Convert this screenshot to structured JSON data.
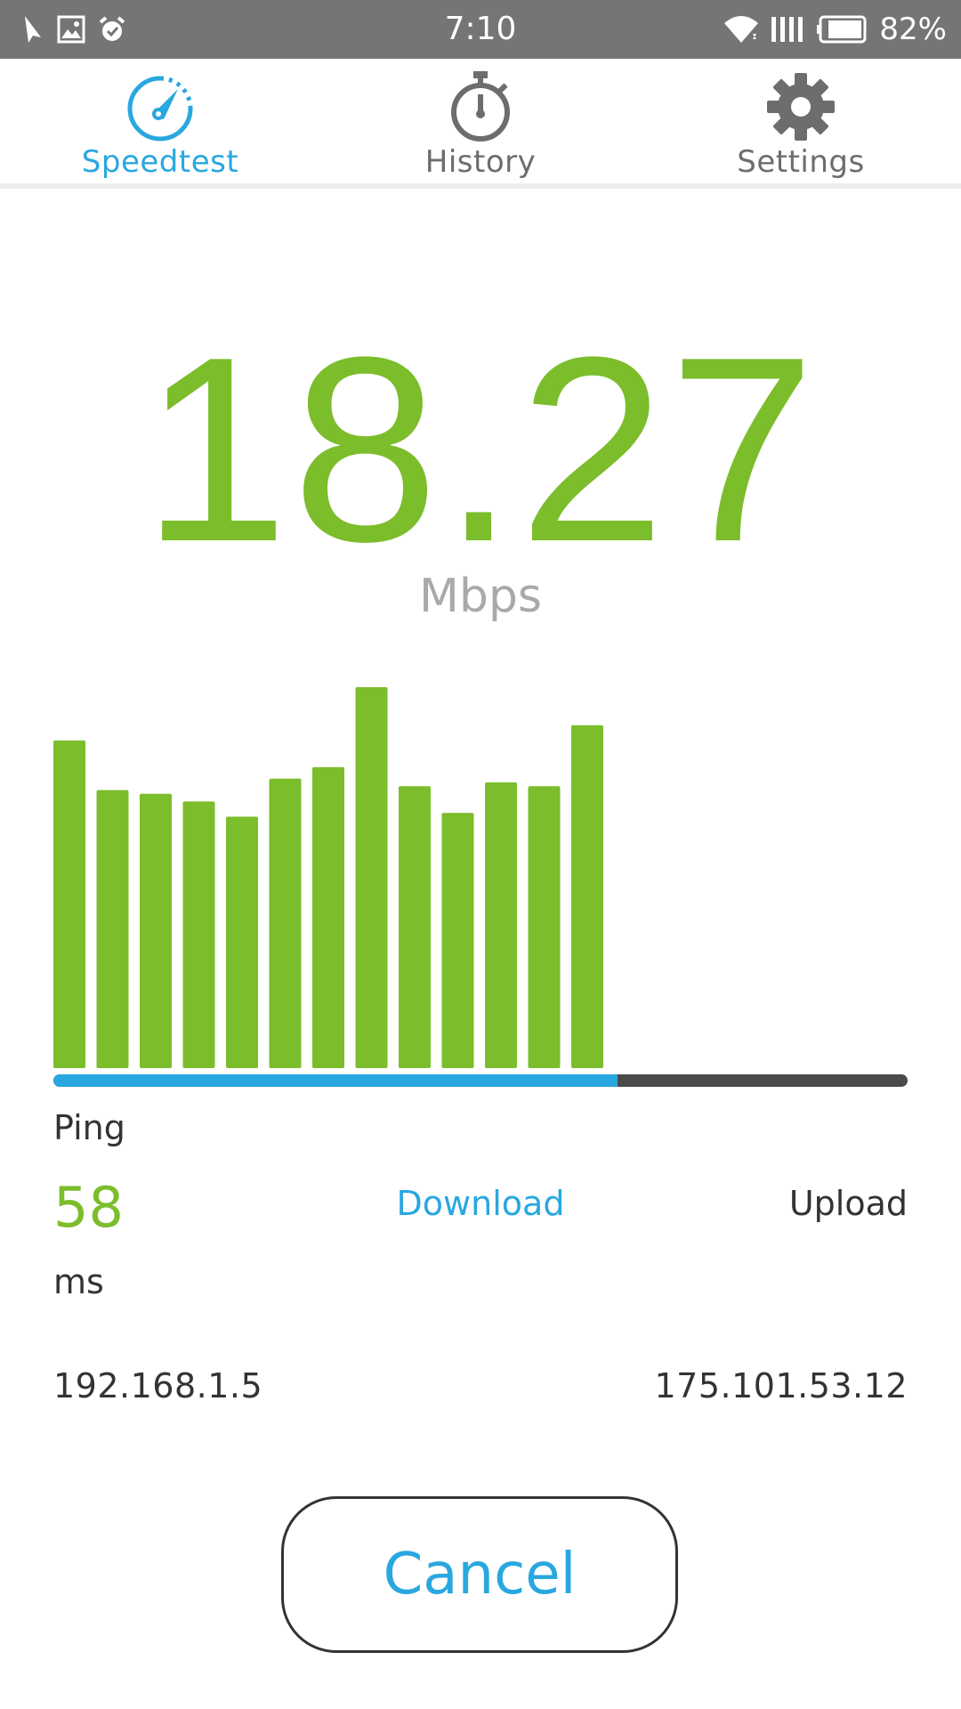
{
  "status_bar": {
    "time": "7:10",
    "battery": "82%",
    "left_icons": [
      "navigation-icon",
      "image-icon",
      "alarm-icon"
    ],
    "right_icons": [
      "wifi-icon",
      "signal-icon",
      "battery-icon"
    ]
  },
  "tabs": [
    {
      "label": "Speedtest",
      "icon": "speedometer-icon",
      "active": true
    },
    {
      "label": "History",
      "icon": "stopwatch-icon",
      "active": false
    },
    {
      "label": "Settings",
      "icon": "gear-icon",
      "active": false
    }
  ],
  "speed": {
    "value": "18.27",
    "unit": "Mbps"
  },
  "chart_data": {
    "type": "bar",
    "values": [
      0.86,
      0.73,
      0.72,
      0.7,
      0.66,
      0.76,
      0.79,
      1.0,
      0.74,
      0.67,
      0.75,
      0.74,
      0.9
    ],
    "slots": 20,
    "ylim": [
      0,
      1
    ],
    "grid": false
  },
  "progress": {
    "fraction": 0.66
  },
  "stats": {
    "ping_label": "Ping",
    "ping_value": "58",
    "ping_unit": "ms",
    "download_label": "Download",
    "upload_label": "Upload",
    "local_ip": "192.168.1.5",
    "server_ip": "175.101.53.12"
  },
  "actions": {
    "cancel_label": "Cancel"
  },
  "colors": {
    "accent_blue": "#29a7df",
    "accent_green": "#7bbd2b",
    "track_dark": "#4a4a4a",
    "status_bar": "#757575"
  }
}
